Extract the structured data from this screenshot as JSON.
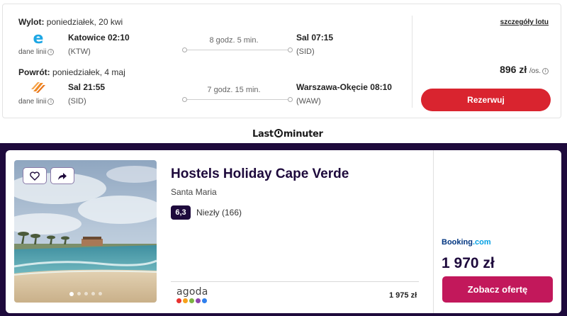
{
  "flight": {
    "outbound": {
      "label": "Wylot:",
      "date": "poniedziałek, 20 kwi",
      "airline_sub": "dane linii",
      "from_city_time": "Katowice 02:10",
      "from_code": "(KTW)",
      "duration": "8 godz. 5 min.",
      "to_city_time": "Sal 07:15",
      "to_code": "(SID)"
    },
    "return": {
      "label": "Powrót:",
      "date": "poniedziałek, 4 maj",
      "airline_sub": "dane linii",
      "from_city_time": "Sal 21:55",
      "from_code": "(SID)",
      "duration": "7 godz. 15 min.",
      "to_city_time": "Warszawa-Okęcie 08:10",
      "to_code": "(WAW)"
    },
    "details_link": "szczegóły lotu",
    "price": "896 zł",
    "price_unit": "/os.",
    "reserve_button": "Rezerwuj"
  },
  "brand": {
    "name_part1": "Last",
    "name_part2": "minuter"
  },
  "hotel": {
    "name": "Hostels Holiday Cape Verde",
    "location": "Santa Maria",
    "rating_score": "6,3",
    "rating_text": "Niezły (166)",
    "partner_agoda": "agoda",
    "agoda_price": "1 975 zł",
    "partner_booking_name": "Booking",
    "partner_booking_suffix": ".com",
    "price": "1 970 zł",
    "offer_button": "Zobacz ofertę",
    "photo_count": 5,
    "photo_active_index": 0
  },
  "colors": {
    "reserve": "#d9242f",
    "hotel_bg": "#1e0a3c",
    "offer": "#c2185b",
    "booking": "#003580"
  }
}
